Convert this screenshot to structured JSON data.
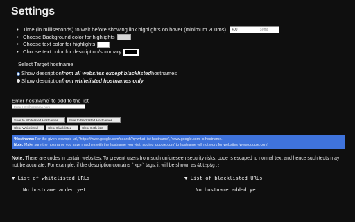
{
  "title": "Settings",
  "options": {
    "delay_label": "Time (in milliseconds) to wait before showing link highlights on hover (minimum 200ms)",
    "delay_value": "400",
    "delay_unit": "≥0ms",
    "bg_label": "Choose Background color for highlights",
    "text_label": "Choose text color for highlights",
    "desc_label": "Choose text color for description/summary"
  },
  "colors": {
    "bg_swatch": "#d8d8d8",
    "text_swatch": "#ffffff",
    "desc_swatch": "#ffffff",
    "accent": "#3f73dc"
  },
  "target": {
    "legend": "Select Target hostname",
    "r1_prefix": "Show description ",
    "r1_bold": "from all websites except blacklisted",
    "r1_suffix": " hostnames",
    "r2_prefix": "Show description ",
    "r2_bold": "from whitelisted hostnames only"
  },
  "hostname": {
    "label_a": "Enter hostname",
    "label_sup": "*",
    "label_b": " to add to the list",
    "placeholder": "Enter URL/hostname here"
  },
  "buttons": {
    "save_white": "Save to Whitelisted Hostnames",
    "save_black": "Save to blacklisted Hostnames",
    "clear_white": "Clear Whitelisted",
    "clear_black": "Clear Blacklisted",
    "clear_both": "Clear Both lists"
  },
  "note_blue": {
    "h_label": "*Hostname:",
    "h_text": " For the given example url, \"https://www.google.com/search?q=what+is+hostname\", 'www.google.com' is hostname.",
    "n_label": "Note:",
    "n_text": " Make sure the hostname you save matches with the hostname you visit. adding 'google.com' to hostname will not work for websites 'www.google.com'"
  },
  "note2": {
    "label": "Note:",
    "text_a": " There are codes in certain websites. To prevent users from such unforeseen security risks, code is escaped to normal text and hence such texts may not be accurate. For example: if the description contains ",
    "code1": "`<p>`",
    "text_b": " tags, it will be shown as ",
    "code2": "&lt;p&gt;"
  },
  "lists": {
    "white_title": "▼ List of whitelisted URLs",
    "white_empty": "No hostname added yet.",
    "black_title": "▼ List of blacklisted URLs",
    "black_empty": "No hostname added yet."
  }
}
